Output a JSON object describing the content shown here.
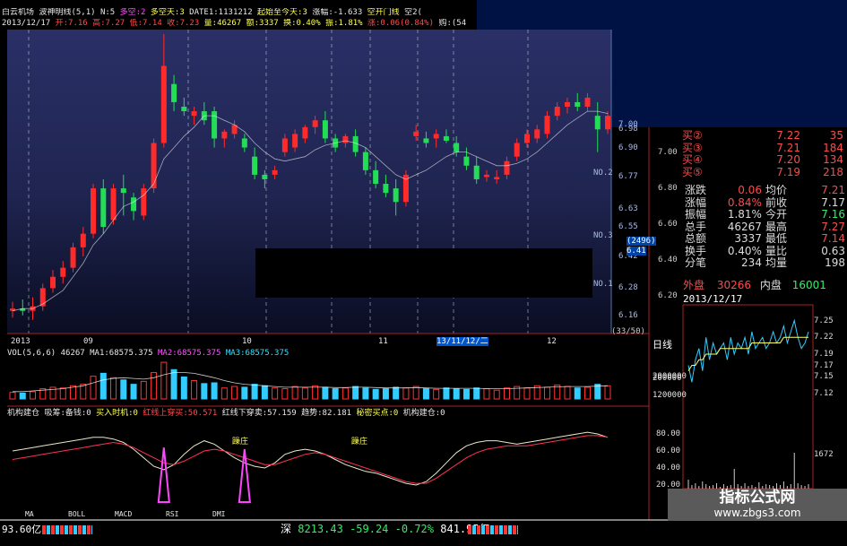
{
  "title_bar": {
    "stock_name": "白云机场",
    "indicator_name": "波神明线(5,1)",
    "n_value": "N:5",
    "status_1": "多空:2",
    "status_2": "多空天:3",
    "date_field": "DATE1:1131212",
    "start_label": "起始至今天:3",
    "rise_label": "涨幅:-1.633",
    "gap_label": "空开门线",
    "extra_label": "空2("
  },
  "info_bar": {
    "date": "2013/12/17",
    "open": "开:7.16",
    "high": "高:7.27",
    "low": "低:7.14",
    "close": "收:7.23",
    "volume": "量:46267",
    "amount": "额:3337",
    "turnover": "换:0.40%",
    "amplitude": "振:1.81%",
    "limit": "涨:0.06(0.84%)",
    "bid": "购:(54"
  },
  "main_chart": {
    "right_price_ticks": [
      "7.00",
      "6.98",
      "6.90",
      "6.77",
      "6.63",
      "6.55",
      "6.42",
      "6.28",
      "6.16"
    ],
    "no_labels": [
      "NO.2",
      "NO.3",
      "NO.1"
    ],
    "side_tag": "(2496)",
    "side_price": "6.41",
    "bottom_tag": "(33/50)"
  },
  "chart_data": {
    "type": "candlestick",
    "candles": [
      {
        "o": 6.18,
        "h": 6.22,
        "l": 6.15,
        "c": 6.19
      },
      {
        "o": 6.19,
        "h": 6.23,
        "l": 6.16,
        "c": 6.18
      },
      {
        "o": 6.18,
        "h": 6.24,
        "l": 6.14,
        "c": 6.2
      },
      {
        "o": 6.2,
        "h": 6.3,
        "l": 6.18,
        "c": 6.28
      },
      {
        "o": 6.28,
        "h": 6.36,
        "l": 6.26,
        "c": 6.33
      },
      {
        "o": 6.33,
        "h": 6.4,
        "l": 6.3,
        "c": 6.37
      },
      {
        "o": 6.37,
        "h": 6.48,
        "l": 6.35,
        "c": 6.46
      },
      {
        "o": 6.46,
        "h": 6.55,
        "l": 6.42,
        "c": 6.52
      },
      {
        "o": 6.52,
        "h": 6.74,
        "l": 6.5,
        "c": 6.72
      },
      {
        "o": 6.72,
        "h": 6.76,
        "l": 6.52,
        "c": 6.55
      },
      {
        "o": 6.58,
        "h": 6.74,
        "l": 6.56,
        "c": 6.72
      },
      {
        "o": 6.72,
        "h": 6.78,
        "l": 6.6,
        "c": 6.7
      },
      {
        "o": 6.68,
        "h": 6.7,
        "l": 6.58,
        "c": 6.62
      },
      {
        "o": 6.6,
        "h": 6.74,
        "l": 6.58,
        "c": 6.72
      },
      {
        "o": 6.72,
        "h": 6.94,
        "l": 6.7,
        "c": 6.92
      },
      {
        "o": 6.92,
        "h": 7.4,
        "l": 6.9,
        "c": 7.26
      },
      {
        "o": 7.18,
        "h": 7.22,
        "l": 7.06,
        "c": 7.1
      },
      {
        "o": 7.08,
        "h": 7.12,
        "l": 7.04,
        "c": 7.06
      },
      {
        "o": 7.04,
        "h": 7.08,
        "l": 7.0,
        "c": 7.06
      },
      {
        "o": 7.06,
        "h": 7.1,
        "l": 7.0,
        "c": 7.02
      },
      {
        "o": 7.06,
        "h": 7.08,
        "l": 6.9,
        "c": 6.94
      },
      {
        "o": 6.94,
        "h": 6.98,
        "l": 6.9,
        "c": 6.97
      },
      {
        "o": 6.96,
        "h": 7.02,
        "l": 6.94,
        "c": 7.0
      },
      {
        "o": 6.94,
        "h": 6.96,
        "l": 6.88,
        "c": 6.9
      },
      {
        "o": 6.86,
        "h": 6.9,
        "l": 6.76,
        "c": 6.78
      },
      {
        "o": 6.78,
        "h": 6.8,
        "l": 6.72,
        "c": 6.76
      },
      {
        "o": 6.78,
        "h": 6.82,
        "l": 6.76,
        "c": 6.8
      },
      {
        "o": 6.88,
        "h": 6.96,
        "l": 6.86,
        "c": 6.94
      },
      {
        "o": 6.9,
        "h": 6.98,
        "l": 6.88,
        "c": 6.96
      },
      {
        "o": 6.94,
        "h": 7.0,
        "l": 6.92,
        "c": 6.99
      },
      {
        "o": 6.99,
        "h": 7.04,
        "l": 6.96,
        "c": 7.02
      },
      {
        "o": 7.02,
        "h": 7.06,
        "l": 6.92,
        "c": 6.94
      },
      {
        "o": 6.94,
        "h": 6.96,
        "l": 6.88,
        "c": 6.9
      },
      {
        "o": 6.92,
        "h": 6.96,
        "l": 6.9,
        "c": 6.95
      },
      {
        "o": 6.95,
        "h": 6.98,
        "l": 6.86,
        "c": 6.88
      },
      {
        "o": 6.88,
        "h": 6.9,
        "l": 6.78,
        "c": 6.8
      },
      {
        "o": 6.8,
        "h": 6.84,
        "l": 6.72,
        "c": 6.74
      },
      {
        "o": 6.74,
        "h": 6.78,
        "l": 6.68,
        "c": 6.7
      },
      {
        "o": 6.72,
        "h": 6.76,
        "l": 6.6,
        "c": 6.66
      },
      {
        "o": 6.66,
        "h": 6.8,
        "l": 6.64,
        "c": 6.78
      },
      {
        "o": 6.95,
        "h": 7.0,
        "l": 6.93,
        "c": 6.97
      },
      {
        "o": 6.94,
        "h": 6.97,
        "l": 6.9,
        "c": 6.92
      },
      {
        "o": 6.94,
        "h": 6.98,
        "l": 6.9,
        "c": 6.96
      },
      {
        "o": 6.95,
        "h": 6.98,
        "l": 6.92,
        "c": 6.93
      },
      {
        "o": 6.92,
        "h": 6.95,
        "l": 6.86,
        "c": 6.88
      },
      {
        "o": 6.86,
        "h": 6.9,
        "l": 6.8,
        "c": 6.82
      },
      {
        "o": 6.82,
        "h": 6.86,
        "l": 6.74,
        "c": 6.76
      },
      {
        "o": 6.77,
        "h": 6.8,
        "l": 6.75,
        "c": 6.78
      },
      {
        "o": 6.76,
        "h": 6.8,
        "l": 6.74,
        "c": 6.77
      },
      {
        "o": 6.78,
        "h": 6.86,
        "l": 6.76,
        "c": 6.84
      },
      {
        "o": 6.86,
        "h": 6.94,
        "l": 6.84,
        "c": 6.92
      },
      {
        "o": 6.92,
        "h": 6.98,
        "l": 6.9,
        "c": 6.96
      },
      {
        "o": 6.94,
        "h": 7.0,
        "l": 6.92,
        "c": 6.98
      },
      {
        "o": 6.96,
        "h": 7.06,
        "l": 6.94,
        "c": 7.04
      },
      {
        "o": 7.04,
        "h": 7.1,
        "l": 7.02,
        "c": 7.08
      },
      {
        "o": 7.08,
        "h": 7.12,
        "l": 7.05,
        "c": 7.1
      },
      {
        "o": 7.1,
        "h": 7.14,
        "l": 7.06,
        "c": 7.08
      },
      {
        "o": 7.08,
        "h": 7.14,
        "l": 7.06,
        "c": 7.12
      },
      {
        "o": 7.04,
        "h": 7.1,
        "l": 6.88,
        "c": 6.98
      },
      {
        "o": 6.98,
        "h": 7.06,
        "l": 6.96,
        "c": 7.04
      }
    ],
    "ma_price": [
      6.18,
      6.19,
      6.19,
      6.21,
      6.24,
      6.27,
      6.33,
      6.39,
      6.47,
      6.52,
      6.58,
      6.64,
      6.66,
      6.69,
      6.74,
      6.85,
      6.9,
      6.95,
      6.99,
      7.04,
      7.04,
      7.02,
      7.0,
      6.97,
      6.92,
      6.88,
      6.85,
      6.84,
      6.85,
      6.86,
      6.89,
      6.91,
      6.92,
      6.93,
      6.92,
      6.9,
      6.86,
      6.82,
      6.78,
      6.76,
      6.78,
      6.8,
      6.83,
      6.86,
      6.88,
      6.88,
      6.86,
      6.84,
      6.82,
      6.82,
      6.83,
      6.85,
      6.88,
      6.92,
      6.96,
      7.0,
      7.03,
      7.06,
      7.06,
      7.05
    ],
    "volume": [
      18,
      16,
      20,
      28,
      32,
      30,
      36,
      40,
      62,
      70,
      58,
      52,
      40,
      48,
      72,
      100,
      80,
      60,
      50,
      42,
      44,
      30,
      34,
      32,
      40,
      36,
      30,
      28,
      34,
      30,
      36,
      32,
      28,
      30,
      34,
      30,
      26,
      28,
      32,
      30,
      34,
      28,
      26,
      30,
      28,
      26,
      30,
      28,
      24,
      30,
      34,
      30,
      36,
      32,
      38,
      34,
      30,
      32,
      40,
      36
    ],
    "vol_ma": [
      20,
      20,
      22,
      24,
      26,
      28,
      32,
      36,
      44,
      52,
      56,
      58,
      56,
      54,
      58,
      66,
      72,
      72,
      70,
      64,
      58,
      50,
      44,
      40,
      38,
      36,
      34,
      32,
      32,
      32,
      32,
      32,
      31,
      31,
      32,
      32,
      31,
      30,
      30,
      30,
      31,
      30,
      29,
      29,
      29,
      29,
      29,
      28,
      28,
      28,
      29,
      30,
      31,
      32,
      33,
      34,
      34,
      34,
      35,
      36
    ],
    "osc_a": [
      60,
      62,
      64,
      66,
      68,
      70,
      72,
      74,
      76,
      76,
      74,
      70,
      62,
      52,
      42,
      38,
      44,
      56,
      66,
      72,
      68,
      60,
      52,
      46,
      42,
      40,
      46,
      56,
      60,
      62,
      60,
      56,
      50,
      44,
      40,
      36,
      34,
      30,
      26,
      22,
      20,
      24,
      34,
      46,
      58,
      66,
      70,
      72,
      72,
      70,
      68,
      70,
      72,
      74,
      76,
      78,
      80,
      82,
      80,
      76
    ],
    "osc_b": [
      50,
      52,
      54,
      56,
      58,
      60,
      62,
      64,
      66,
      68,
      70,
      68,
      64,
      58,
      52,
      46,
      44,
      48,
      54,
      60,
      62,
      60,
      56,
      52,
      48,
      44,
      44,
      48,
      52,
      56,
      58,
      56,
      52,
      48,
      44,
      40,
      36,
      32,
      28,
      24,
      22,
      22,
      28,
      36,
      44,
      52,
      58,
      62,
      64,
      66,
      66,
      66,
      68,
      70,
      72,
      74,
      76,
      78,
      78,
      76
    ],
    "pulses": [
      {
        "i": 15,
        "h": 64
      },
      {
        "i": 23,
        "h": 62
      }
    ],
    "volume_axis": [
      "2000000",
      "1200000"
    ],
    "osc_axis": [
      "80.00",
      "60.00",
      "40.00",
      "20.00"
    ]
  },
  "date_axis": {
    "labels": [
      "2013",
      "09",
      "10",
      "11",
      "13/11/12/二",
      "12"
    ]
  },
  "vol_header": {
    "name": "VOL(5,6,6)",
    "value": "46267",
    "ma1": "MA1:68575.375",
    "ma2": "MA2:68575.375",
    "ma3": "MA3:68575.375"
  },
  "ind_header": {
    "name": "机构建仓",
    "t1": "吸筹:备钱:0",
    "t2": "买入时机:0",
    "t3": "红线上穿买:50.571",
    "t4": "红线下穿卖:57.159",
    "t5": "趋势:82.181",
    "t6": "秘密买点:0",
    "t7": "机构建仓:0"
  },
  "annotations": {
    "label_1": "躁庄",
    "label_2": "躁庄"
  },
  "bottom_tabs": [
    "MA",
    "BOLL",
    "MACD",
    "RSI",
    "DMI"
  ],
  "status_bar": {
    "left_value": "93.60亿",
    "market": "深",
    "index_value": "8213.43",
    "index_change": "-59.24",
    "index_pct": "-0.72%",
    "index_amount": "841.95亿"
  },
  "quote_panel": {
    "rows": [
      {
        "label": "买②",
        "price": "7.22",
        "vol": "35"
      },
      {
        "label": "买③",
        "price": "7.21",
        "vol": "184"
      },
      {
        "label": "买④",
        "price": "7.20",
        "vol": "134"
      },
      {
        "label": "买⑤",
        "price": "7.19",
        "vol": "218"
      }
    ],
    "left_ticks": [
      "7.00",
      "6.80",
      "6.60",
      "6.40",
      "6.20"
    ],
    "stats": [
      {
        "l1": "涨跌",
        "v1": "0.06",
        "l2": "均价",
        "v2": "7.21"
      },
      {
        "l1": "涨幅",
        "v1": "0.84%",
        "l2": "前收",
        "v2": "7.17"
      },
      {
        "l1": "振幅",
        "v1": "1.81%",
        "l2": "今开",
        "v2": "7.16"
      },
      {
        "l1": "总手",
        "v1": "46267",
        "l2": "最高",
        "v2": "7.27"
      },
      {
        "l1": "总额",
        "v1": "3337",
        "l2": "最低",
        "v2": "7.14"
      },
      {
        "l1": "换手",
        "v1": "0.40%",
        "l2": "量比",
        "v2": "0.63"
      },
      {
        "l1": "分笔",
        "v1": "234",
        "l2": "均量",
        "v2": "198"
      }
    ],
    "outer": "外盘",
    "outer_val": "30266",
    "inner": "内盘",
    "inner_val": "16001",
    "date": "2013/12/17",
    "daily_label": "日线",
    "volume_label": "200000"
  },
  "mini_chart": {
    "ticks": [
      "7.25",
      "7.22",
      "7.19",
      "7.17",
      "7.15",
      "7.12"
    ],
    "vol_label": "1672",
    "series": [
      7.17,
      7.14,
      7.18,
      7.2,
      7.16,
      7.22,
      7.18,
      7.21,
      7.19,
      7.2,
      7.21,
      7.18,
      7.22,
      7.19,
      7.21,
      7.2,
      7.22,
      7.19,
      7.23,
      7.2,
      7.21,
      7.22,
      7.2,
      7.21,
      7.23,
      7.21,
      7.22,
      7.24,
      7.21,
      7.23,
      7.25,
      7.22,
      7.2,
      7.21,
      7.23
    ],
    "avg": [
      7.16,
      7.17,
      7.17,
      7.18,
      7.18,
      7.19,
      7.19,
      7.19,
      7.19,
      7.2,
      7.2,
      7.2,
      7.2,
      7.2,
      7.2,
      7.2,
      7.2,
      7.2,
      7.21,
      7.21,
      7.21,
      7.21,
      7.21,
      7.21,
      7.21,
      7.21,
      7.21,
      7.22,
      7.22,
      7.22,
      7.22,
      7.22,
      7.22,
      7.22,
      7.22
    ],
    "bars": [
      10,
      4,
      6,
      3,
      8,
      5,
      3,
      4,
      6,
      2,
      5,
      3,
      4,
      22,
      5,
      3,
      6,
      3,
      4,
      2,
      7,
      3,
      5,
      4,
      3,
      6,
      4,
      8,
      3,
      5,
      40,
      6,
      4,
      3,
      5
    ]
  },
  "watermark": {
    "line1": "指标公式网",
    "line2": "www.zbgs3.com"
  }
}
